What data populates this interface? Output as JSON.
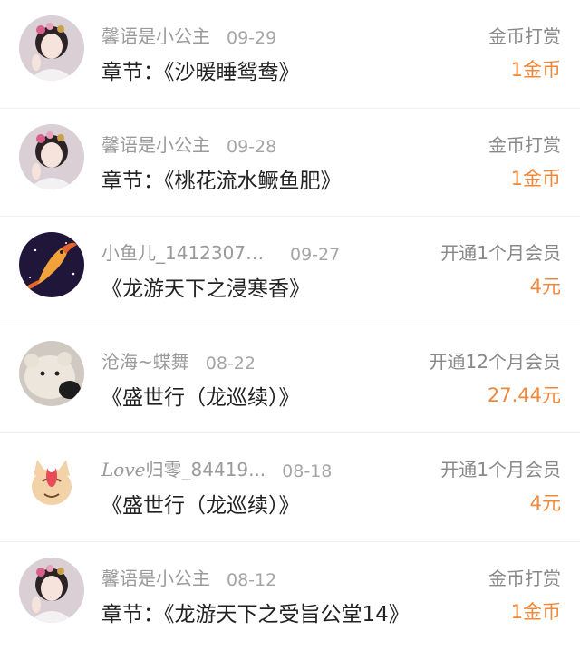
{
  "colors": {
    "accent": "#f0883a",
    "muted": "#9a9a9a",
    "text": "#222222"
  },
  "rows": [
    {
      "name": "馨语是小公主",
      "date": "09-29",
      "title": "章节：《沙暖睡鸳鸯》",
      "type": "金币打赏",
      "amount": "1金币",
      "avatar": "princess-avatar"
    },
    {
      "name": "馨语是小公主",
      "date": "09-28",
      "title": "章节：《桃花流水鳜鱼肥》",
      "type": "金币打赏",
      "amount": "1金币",
      "avatar": "princess-avatar"
    },
    {
      "name": "小鱼儿_14123070...",
      "date": "09-27",
      "title": "《龙游天下之浸寒香》",
      "type": "开通1个月会员",
      "amount": "4元",
      "avatar": "goldfish-avatar"
    },
    {
      "name": "沧海~蝶舞",
      "date": "08-22",
      "title": "《盛世行（龙巡续）》",
      "type": "开通12个月会员",
      "amount": "27.44元",
      "avatar": "plush-bear-avatar"
    },
    {
      "name_prefix": "Love",
      "name": "归零_84419...",
      "date": "08-18",
      "title": "《盛世行（龙巡续）》",
      "type": "开通1个月会员",
      "amount": "4元",
      "avatar": "cartoon-cat-avatar"
    },
    {
      "name": "馨语是小公主",
      "date": "08-12",
      "title": "章节：《龙游天下之受旨公堂14》",
      "type": "金币打赏",
      "amount": "1金币",
      "avatar": "princess-avatar"
    }
  ]
}
